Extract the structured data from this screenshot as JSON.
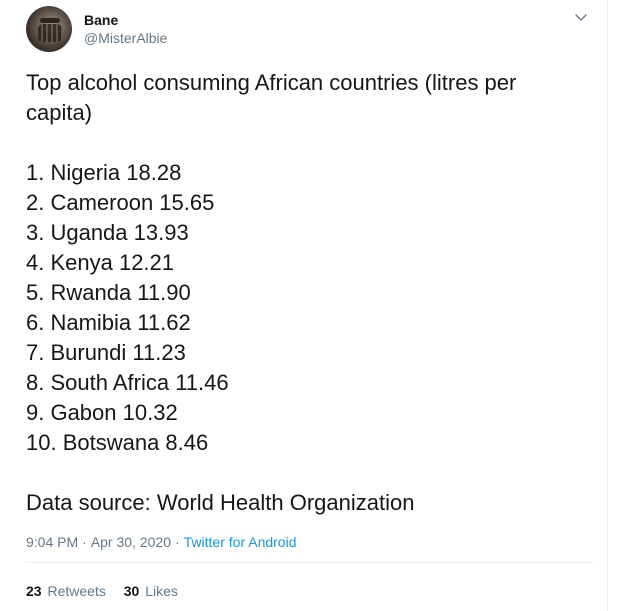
{
  "author": {
    "display_name": "Bane",
    "handle": "@MisterAlbie"
  },
  "icons": {
    "menu": "chevron-down-icon"
  },
  "tweet": {
    "title_line_1": "Top alcohol consuming African countries (litres per",
    "title_line_2": "capita)",
    "items": [
      "1. Nigeria 18.28",
      "2. Cameroon 15.65",
      "3. Uganda 13.93",
      "4. Kenya 12.21",
      "5. Rwanda 11.90",
      "6. Namibia 11.62",
      "7. Burundi 11.23",
      "8. South Africa 11.46",
      "9. Gabon 10.32",
      "10. Botswana 8.46"
    ],
    "source": "Data source: World Health Organization"
  },
  "meta": {
    "time": "9:04 PM",
    "separator": "·",
    "date": "Apr 30, 2020",
    "client": "Twitter for Android"
  },
  "stats": {
    "retweets_count": "23",
    "retweets_label": "Retweets",
    "likes_count": "30",
    "likes_label": "Likes"
  },
  "colors": {
    "text": "#14171a",
    "muted": "#657786",
    "link": "#1b95e0",
    "divider": "#e6ecf0"
  }
}
